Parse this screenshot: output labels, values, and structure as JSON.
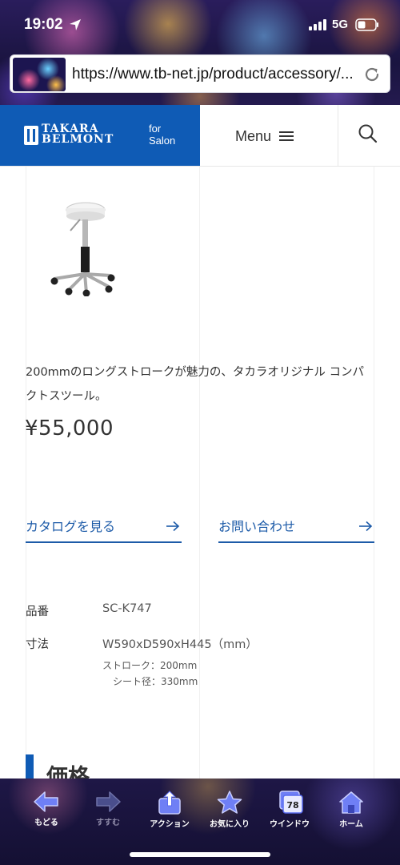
{
  "status_bar": {
    "time": "19:02",
    "network": "5G"
  },
  "browser": {
    "url": "https://www.tb-net.jp/product/accessory/..."
  },
  "header": {
    "brand_line1": "TAKARA",
    "brand_line2": "BELMONT",
    "brand_sub_line1": "for",
    "brand_sub_line2": "Salon",
    "menu_label": "Menu",
    "brand_color": "#0f5bb5"
  },
  "product": {
    "image_icon": "stool-icon",
    "description": "200mmのロングストロークが魅力の、タカラオリジナル コンパクトスツール。",
    "price": "¥55,000",
    "actions": [
      {
        "label": "カタログを見る"
      },
      {
        "label": "お問い合わせ"
      }
    ],
    "specs": [
      {
        "label": "品番",
        "value": "SC-K747"
      },
      {
        "label": "寸法",
        "value": "W590xD590xH445（mm）"
      }
    ],
    "spec_notes": [
      "ストローク：200mm",
      "シート径：330mm"
    ],
    "section_heading": "価格"
  },
  "toolbar": {
    "items": [
      {
        "label": "もどる",
        "icon": "back-arrow-icon",
        "enabled": true
      },
      {
        "label": "すすむ",
        "icon": "forward-arrow-icon",
        "enabled": false
      },
      {
        "label": "アクション",
        "icon": "share-icon",
        "enabled": true
      },
      {
        "label": "お気に入り",
        "icon": "star-icon",
        "enabled": true
      },
      {
        "label": "ウインドウ",
        "icon": "windows-icon",
        "enabled": true,
        "badge": "78"
      },
      {
        "label": "ホーム",
        "icon": "home-icon",
        "enabled": true
      }
    ]
  },
  "colors": {
    "accent": "#1d5ba8",
    "toolbar_icon": "#5a6cf0"
  }
}
